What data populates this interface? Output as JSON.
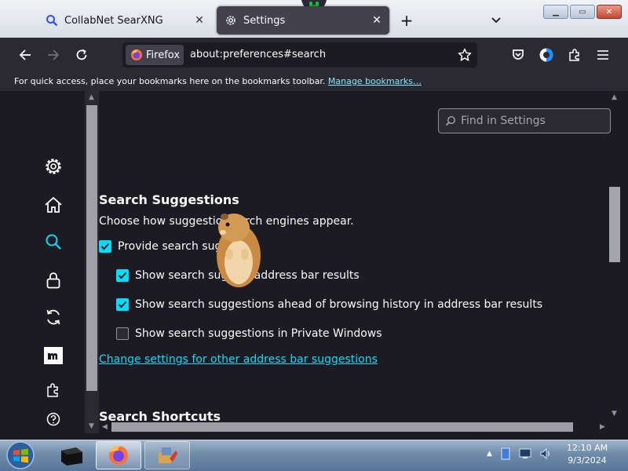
{
  "tabs": [
    {
      "title": "CollabNet SearXNG",
      "icon": "search-icon"
    },
    {
      "title": "Settings",
      "icon": "gear-icon"
    }
  ],
  "navbar": {
    "identity_label": "Firefox",
    "url": "about:preferences#search"
  },
  "bookmarks_notice": {
    "text": "For quick access, place your bookmarks here on the bookmarks toolbar.",
    "link": "Manage bookmarks…"
  },
  "find": {
    "placeholder": "Find in Settings"
  },
  "search_suggestions": {
    "heading": "Search Suggestions",
    "description": "Choose how suggestio         search engines appear.",
    "provide": {
      "label": "Provide search sugg",
      "checked": true
    },
    "address_bar": {
      "label": "Show search sug          s in address bar results",
      "checked": true
    },
    "ahead_history": {
      "label": "Show search suggestions ahead of browsing history in address bar results",
      "checked": true
    },
    "private": {
      "label": "Show search suggestions in Private Windows",
      "checked": false
    },
    "change_link": "Change settings for other address bar suggestions"
  },
  "search_shortcuts": {
    "heading": "Search Shortcuts"
  },
  "sidebar": [
    "gear-icon",
    "home-icon",
    "search-icon",
    "lock-icon",
    "sync-icon",
    "more-from-mozilla-icon",
    "extensions-icon",
    "help-icon"
  ],
  "taskbar": {
    "time": "12:10 AM",
    "date": "9/3/2024"
  },
  "colors": {
    "accent": "#00ddff",
    "background": "#1c1b22",
    "toolbar": "#2b2a33"
  }
}
